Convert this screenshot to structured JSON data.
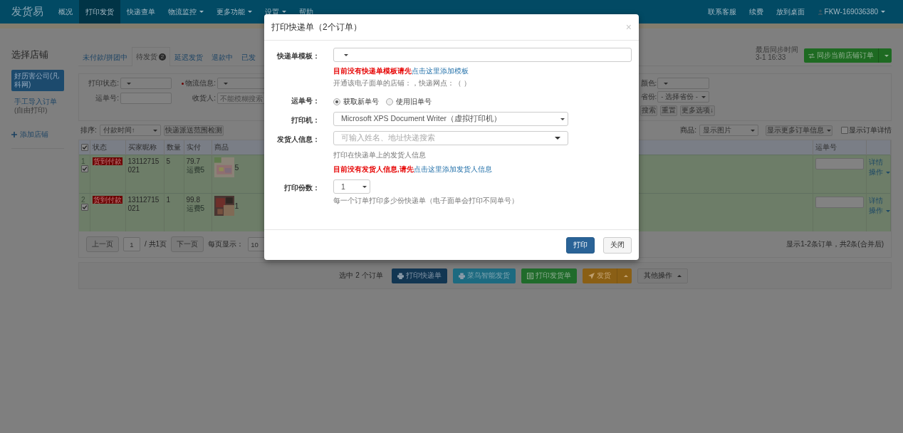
{
  "nav": {
    "logo": "发货易",
    "items": [
      {
        "label": "概况",
        "selected": false,
        "dropdown": false
      },
      {
        "label": "打印发货",
        "selected": true,
        "dropdown": false
      },
      {
        "label": "快递查单",
        "selected": false,
        "dropdown": false
      },
      {
        "label": "物流监控",
        "selected": false,
        "dropdown": true
      },
      {
        "label": "更多功能",
        "selected": false,
        "dropdown": true
      },
      {
        "label": "设置",
        "selected": false,
        "dropdown": true
      },
      {
        "label": "帮助",
        "selected": false,
        "dropdown": false
      }
    ],
    "right_items": [
      "联系客服",
      "续费",
      "放到桌面"
    ],
    "account": "FKW-169036380"
  },
  "sidebar": {
    "title": "选择店铺",
    "shops": [
      {
        "label": "好历害公司(凡科网)",
        "selected": true
      },
      {
        "label": "手工导入订单",
        "sublabel": "(自由打印)",
        "selected": false
      }
    ],
    "add_shop": "添加店铺"
  },
  "tabs": [
    {
      "label": "未付款/拼团中",
      "selected": false
    },
    {
      "label": "待发货",
      "badge": "2",
      "selected": true
    },
    {
      "label": "延迟发货",
      "selected": false
    },
    {
      "label": "退款中",
      "selected": false
    },
    {
      "label": "已发",
      "selected": false
    }
  ],
  "sync": {
    "caption": "最后同步时间",
    "time": "3-1 16:33",
    "button": "同步当前店铺订单"
  },
  "filters": {
    "print_status": {
      "label": "打印状态:"
    },
    "logistics": {
      "label": "物流信息:",
      "required": true
    },
    "waybill": {
      "label": "运单号:"
    },
    "receiver": {
      "label": "收货人:",
      "placeholder": "不能模糊搜索"
    },
    "color": {
      "label": "颜色:"
    },
    "province": {
      "label": "省份:",
      "value": "- 选择省份 -"
    },
    "buttons": [
      "搜索",
      "重置",
      "更多选项↓"
    ]
  },
  "toolbar": {
    "sort_label": "排序:",
    "sort_value": "付款时间↑",
    "check_button": "快递派送范围检测",
    "goods_label": "商品:",
    "goods_value": "显示图片",
    "more_info": "显示更多订单信息",
    "show_details": {
      "label": "显示订单详情",
      "checked": false
    }
  },
  "table": {
    "header_checked": true,
    "columns": [
      "状态",
      "买家昵称",
      "数量",
      "实付",
      "商品",
      "运单号"
    ],
    "rows": [
      {
        "index": "1",
        "checked": true,
        "status": "货到付款",
        "buyer": "13112715021",
        "quantity": "5",
        "paid": "79.7",
        "freight": "运费5",
        "product_count": "5",
        "actions": [
          {
            "label": "详情",
            "dropdown": false
          },
          {
            "label": "操作",
            "dropdown": true
          }
        ]
      },
      {
        "index": "2",
        "checked": true,
        "status": "货到付款",
        "buyer": "13112715021",
        "quantity": "1",
        "paid": "99.8",
        "freight": "运费5",
        "product_count": "1",
        "actions": [
          {
            "label": "详情",
            "dropdown": false
          },
          {
            "label": "操作",
            "dropdown": true
          }
        ]
      }
    ]
  },
  "pager": {
    "prev": "上一页",
    "page": "1",
    "total": "/ 共1页",
    "next": "下一页",
    "per_page_label": "每页显示：",
    "per_page": "10",
    "summary": "显示1-2条订单，共2条(合并后)"
  },
  "bottom": {
    "selection": "选中 2 个订单",
    "actions": [
      {
        "label": "打印快递单",
        "kind": "print"
      },
      {
        "label": "菜鸟智能发货",
        "kind": "cainiao"
      },
      {
        "label": "打印发货单",
        "kind": "invoice"
      },
      {
        "label": "发货",
        "kind": "ship"
      },
      {
        "label": "其他操作",
        "kind": "more"
      }
    ]
  },
  "modal": {
    "title": "打印快递单（2个订单）",
    "close": "×",
    "template": {
      "label": "快递单模板：",
      "warning": "目前没有快递单模板请先",
      "link": "点击这里添加模板",
      "info": "开通该电子面单的店铺：，快递网点：（ ）"
    },
    "waybill": {
      "label": "运单号：",
      "options": [
        {
          "label": "获取新单号",
          "selected": true
        },
        {
          "label": "使用旧单号",
          "selected": false
        }
      ]
    },
    "printer": {
      "label": "打印机：",
      "value": "Microsoft XPS Document Writer（虚拟打印机）"
    },
    "sender": {
      "label": "发货人信息：",
      "placeholder": "可输入姓名、地址快递搜索",
      "help": "打印在快递单上的发货人信息",
      "warning": "目前没有发货人信息,请先",
      "link": "点击这里添加发货人信息"
    },
    "copies": {
      "label": "打印份数：",
      "value": "1",
      "help": "每一个订单打印多少份快递单（电子面单会打印不同单号）"
    },
    "buttons": [
      {
        "label": "打印",
        "kind": "primary"
      },
      {
        "label": "关闭",
        "kind": "default"
      }
    ]
  }
}
